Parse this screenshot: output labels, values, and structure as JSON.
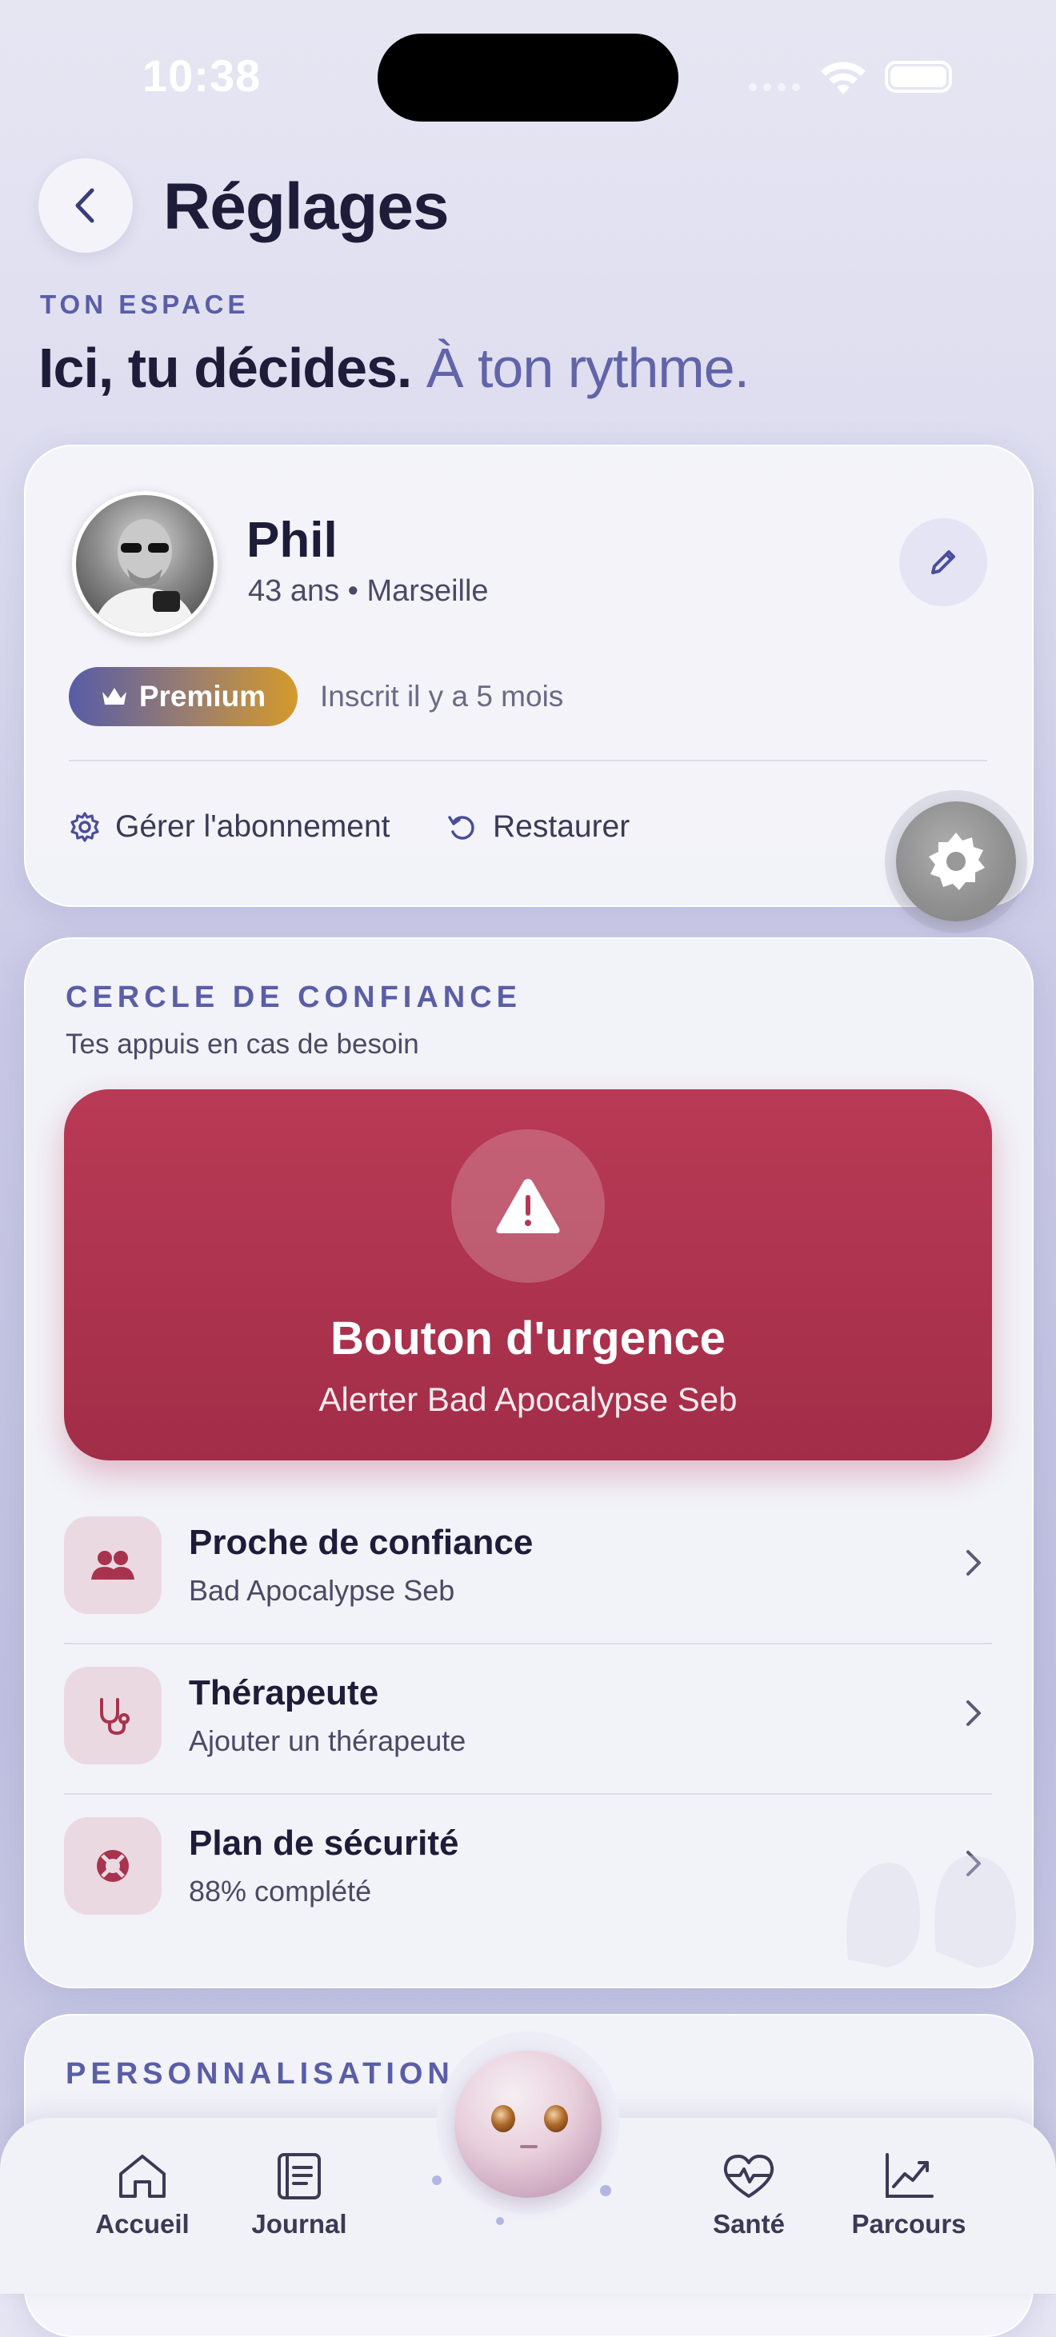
{
  "status_bar": {
    "time": "10:38"
  },
  "header": {
    "title": "Réglages",
    "eyebrow": "TON ESPACE",
    "headline_strong": "Ici, tu décides.",
    "headline_soft": "À ton rythme."
  },
  "profile": {
    "name": "Phil",
    "meta": "43 ans • Marseille",
    "badge": "Premium",
    "joined": "Inscrit il y a 5 mois",
    "manage_label": "Gérer l'abonnement",
    "restore_label": "Restaurer"
  },
  "trust": {
    "label": "CERCLE DE CONFIANCE",
    "subtitle": "Tes appuis en cas de besoin",
    "emergency_title": "Bouton d'urgence",
    "emergency_sub": "Alerter Bad Apocalypse Seb",
    "rows": [
      {
        "title": "Proche de confiance",
        "subtitle": "Bad Apocalypse Seb",
        "icon": "people-icon"
      },
      {
        "title": "Thérapeute",
        "subtitle": "Ajouter un thérapeute",
        "icon": "stethoscope-icon"
      },
      {
        "title": "Plan de sécurité",
        "subtitle": "88% complété",
        "icon": "lifebuoy-icon"
      }
    ]
  },
  "personalisation": {
    "label": "PERSONNALISATION"
  },
  "tabbar": {
    "home": "Accueil",
    "journal": "Journal",
    "health": "Santé",
    "journey": "Parcours"
  },
  "colors": {
    "accent": "#5a5ea6",
    "emergency": "#b93a55",
    "text": "#1d1d3a"
  }
}
